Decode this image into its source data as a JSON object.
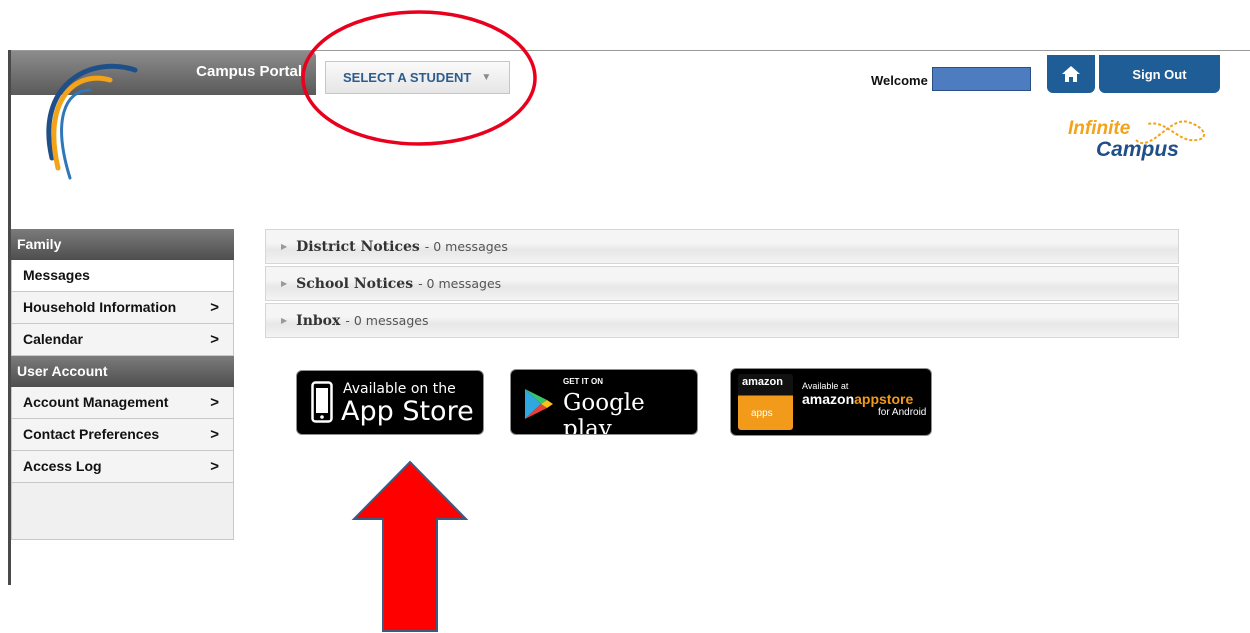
{
  "header": {
    "portal_title": "Campus Portal",
    "student_select": "SELECT A STUDENT",
    "welcome_label": "Welcome",
    "sign_out": "Sign Out",
    "brand_line1": "Infinite",
    "brand_line2": "Campus"
  },
  "sidebar": {
    "sections": [
      {
        "label": "Family",
        "items": [
          {
            "label": "Messages",
            "chevron": ""
          },
          {
            "label": "Household Information",
            "chevron": ">"
          },
          {
            "label": "Calendar",
            "chevron": ">"
          }
        ]
      },
      {
        "label": "User Account",
        "items": [
          {
            "label": "Account Management",
            "chevron": ">"
          },
          {
            "label": "Contact Preferences",
            "chevron": ">"
          },
          {
            "label": "Access Log",
            "chevron": ">"
          }
        ]
      }
    ]
  },
  "notices": [
    {
      "title": "District Notices",
      "count": "- 0 messages"
    },
    {
      "title": "School Notices",
      "count": "- 0 messages"
    },
    {
      "title": "Inbox",
      "count": "- 0 messages"
    }
  ],
  "badges": {
    "appstore": {
      "small": "Available on the",
      "big": "App Store"
    },
    "gplay": {
      "small": "GET IT ON",
      "big": "Google play"
    },
    "amazon": {
      "logo": "amazon",
      "apps": "apps",
      "avail": "Available at",
      "store_a": "amazon",
      "store_b": "appstore",
      "android": "for Android"
    }
  },
  "colors": {
    "accent_blue": "#1e5d96",
    "annotation_red": "#e8001c",
    "arrow_outline": "#3d5a80"
  }
}
